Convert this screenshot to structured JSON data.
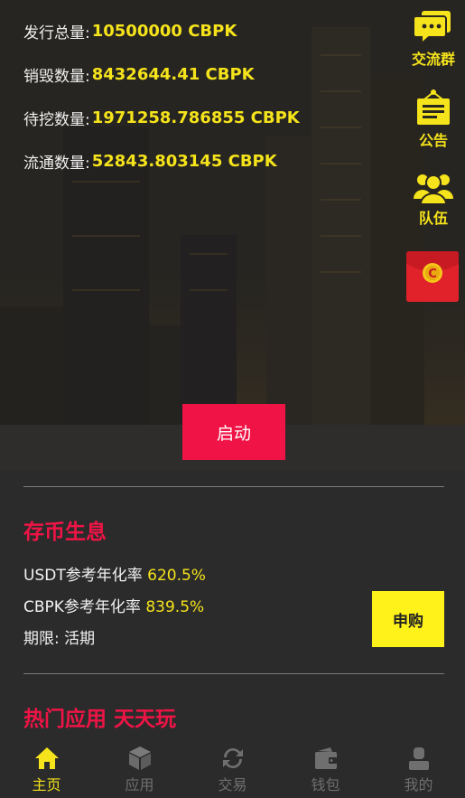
{
  "stats": [
    {
      "label": "发行总量:",
      "value": "10500000 CBPK"
    },
    {
      "label": "销毁数量:",
      "value": "8432644.41 CBPK"
    },
    {
      "label": "待挖数量:",
      "value": "1971258.786855 CBPK"
    },
    {
      "label": "流通数量:",
      "value": "52843.803145 CBPK"
    }
  ],
  "side": {
    "chat_label": "交流群",
    "notice_label": "公告",
    "team_label": "队伍"
  },
  "start_label": "启动",
  "savings": {
    "title": "存币生息",
    "usdt_label": "USDT参考年化率",
    "usdt_rate": "620.5%",
    "cbpk_label": "CBPK参考年化率",
    "cbpk_rate": "839.5%",
    "term_label": "期限:",
    "term_value": "活期",
    "subscribe_label": "申购"
  },
  "hot": {
    "title": "热门应用 天天玩"
  },
  "tabs": [
    {
      "label": "主页",
      "icon": "home-icon",
      "active": true
    },
    {
      "label": "应用",
      "icon": "cube-icon",
      "active": false
    },
    {
      "label": "交易",
      "icon": "refresh-icon",
      "active": false
    },
    {
      "label": "钱包",
      "icon": "wallet-icon",
      "active": false
    },
    {
      "label": "我的",
      "icon": "user-icon",
      "active": false
    }
  ],
  "colors": {
    "accent_yellow": "#f5e31b",
    "accent_red": "#f01446",
    "background": "#2b2b2b"
  }
}
